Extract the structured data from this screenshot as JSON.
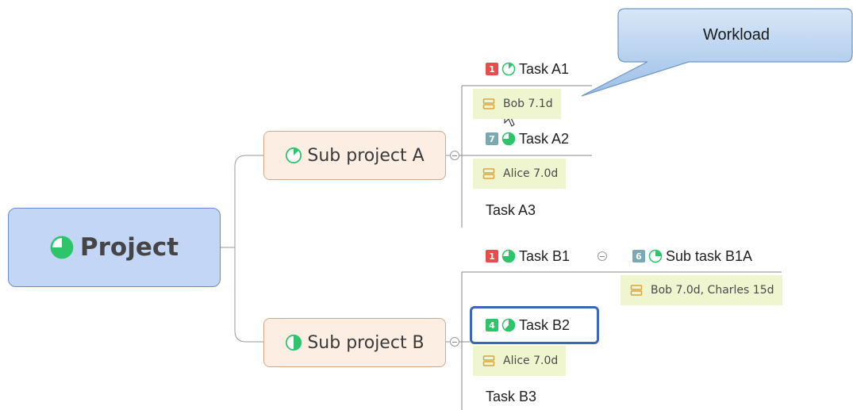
{
  "root": {
    "label": "Project"
  },
  "sub_a": {
    "label": "Sub project A",
    "tasks": [
      {
        "badge": "1",
        "label": "Task A1"
      },
      {
        "badge": "7",
        "label": "Task A2"
      },
      {
        "label": "Task A3"
      }
    ],
    "workloads": [
      "Bob 7.1d",
      "Alice 7.0d"
    ]
  },
  "sub_b": {
    "label": "Sub project B",
    "tasks": [
      {
        "badge": "1",
        "label": "Task B1"
      },
      {
        "badge": "4",
        "label": "Task B2"
      },
      {
        "label": "Task B3"
      }
    ],
    "workloads": [
      "Alice 7.0d"
    ],
    "subtask": {
      "badge": "6",
      "label": "Sub task B1A",
      "workload": "Bob 7.0d, Charles 15d"
    }
  },
  "callout": {
    "label": "Workload"
  },
  "colors": {
    "priority_high": "#e84d4d",
    "priority_low": "#7aa9b3",
    "priority_mid": "#2ec46c",
    "progress_green": "#2ec46c",
    "selection": "#3e66b8",
    "workload_bg": "#eef5cf"
  },
  "icons": {
    "progress": "pie-progress-icon",
    "resource": "resource-stack-icon",
    "collapse": "collapse-minus-icon",
    "pointer": "mouse-pointer-icon"
  }
}
